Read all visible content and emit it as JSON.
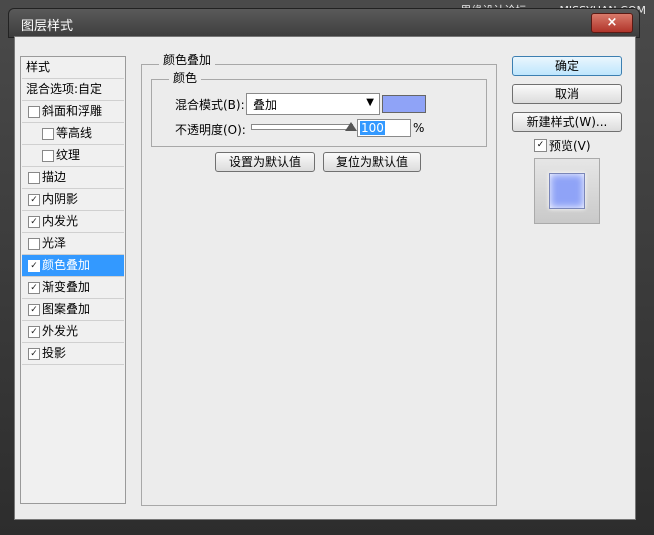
{
  "watermark": "思缘设计论坛 www.MISSYUAN.COM",
  "dialog": {
    "title": "图层样式",
    "close_glyph": "×"
  },
  "styles_list": {
    "header": "样式",
    "blend_options": "混合选项:自定",
    "items": [
      {
        "label": "斜面和浮雕",
        "checked": false,
        "sub": false
      },
      {
        "label": "等高线",
        "checked": false,
        "sub": true
      },
      {
        "label": "纹理",
        "checked": false,
        "sub": true
      },
      {
        "label": "描边",
        "checked": false,
        "sub": false
      },
      {
        "label": "内阴影",
        "checked": true,
        "sub": false
      },
      {
        "label": "内发光",
        "checked": true,
        "sub": false
      },
      {
        "label": "光泽",
        "checked": false,
        "sub": false
      },
      {
        "label": "颜色叠加",
        "checked": true,
        "sub": false,
        "selected": true
      },
      {
        "label": "渐变叠加",
        "checked": true,
        "sub": false
      },
      {
        "label": "图案叠加",
        "checked": true,
        "sub": false
      },
      {
        "label": "外发光",
        "checked": true,
        "sub": false
      },
      {
        "label": "投影",
        "checked": true,
        "sub": false
      }
    ]
  },
  "panel": {
    "section_title": "颜色叠加",
    "group_title": "颜色",
    "blend_mode_label": "混合模式(B):",
    "blend_mode_value": "叠加",
    "color_swatch": "#8fa3f7",
    "opacity_label": "不透明度(O):",
    "opacity_value": "100",
    "opacity_unit": "%",
    "opacity_level": 1.0,
    "make_default": "设置为默认值",
    "reset_default": "复位为默认值"
  },
  "buttons": {
    "ok": "确定",
    "cancel": "取消",
    "new_style": "新建样式(W)...",
    "preview_label": "预览(V)",
    "preview_checked": true
  },
  "check_glyph": "✓"
}
